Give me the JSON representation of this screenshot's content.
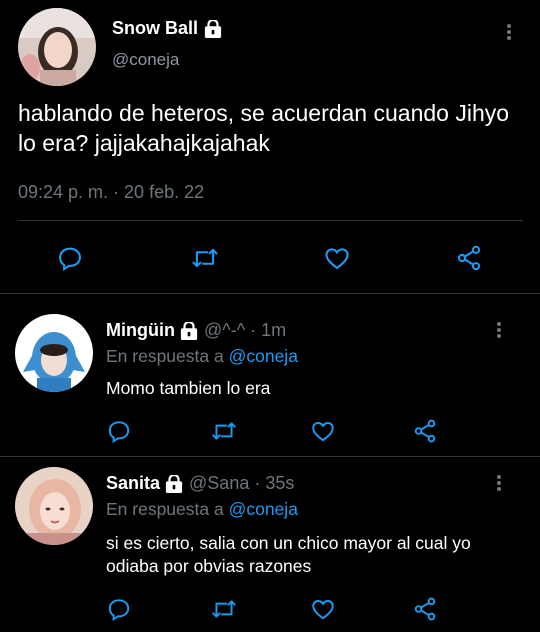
{
  "main": {
    "display_name": "Snow Ball",
    "handle": "@coneja",
    "text": "hablando de heteros, se acuerdan cuando Jihyo lo era? jajjakahajkajahak",
    "timestamp": "09:24 p. m. · 20 feb. 22"
  },
  "replies": [
    {
      "display_name": "Mingüin",
      "handle_time": "@^-^ · 1m",
      "reply_prefix": "En respuesta a",
      "reply_link": "@coneja",
      "text": "Momo tambien lo era"
    },
    {
      "display_name": "Sanita",
      "handle_time": "@Sana · 35s",
      "reply_prefix": "En respuesta a",
      "reply_link": "@coneja",
      "text": "si es cierto, salia con un chico mayor al cual yo odiaba por obvias razones"
    }
  ],
  "icons": [
    "lock-icon",
    "more-options-icon",
    "reply-icon",
    "retweet-icon",
    "like-icon",
    "share-icon"
  ],
  "colors": {
    "background": "#000000",
    "text": "#ffffff",
    "secondary_text": "#6e767d",
    "link": "#1d9bf0",
    "divider": "#2f3336"
  }
}
